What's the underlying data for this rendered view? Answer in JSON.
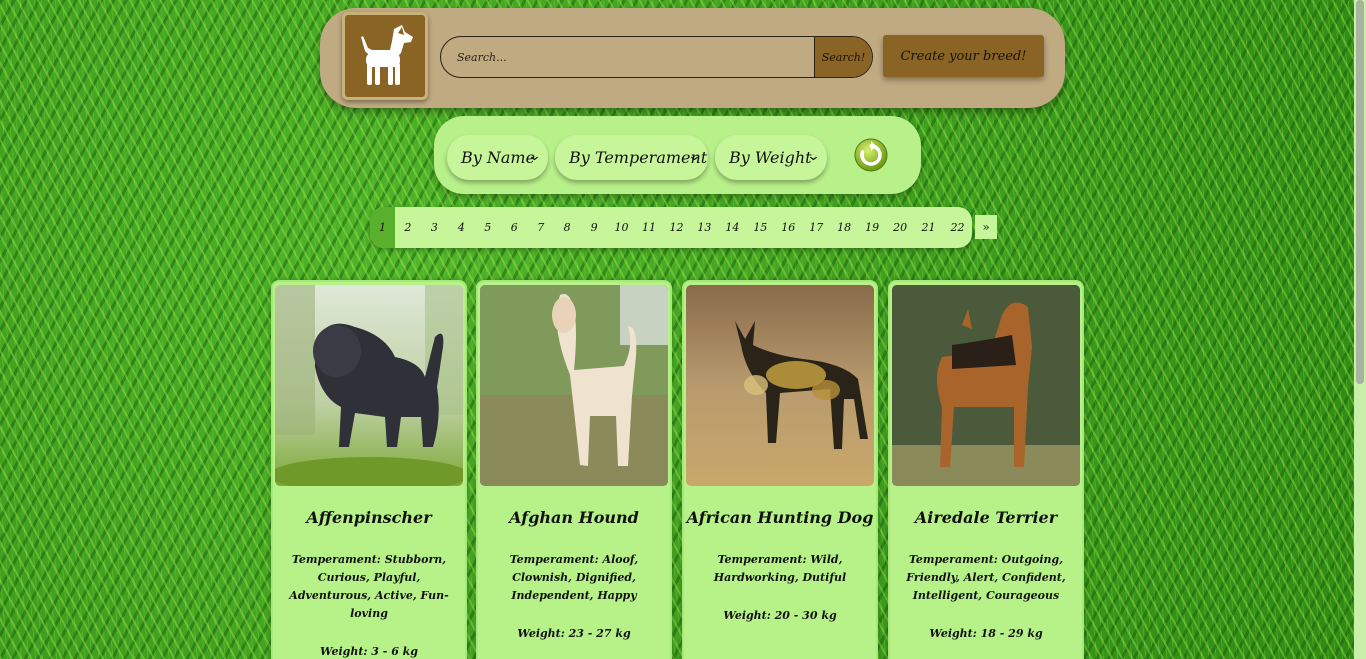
{
  "header": {
    "search_placeholder": "Search...",
    "search_button": "Search!",
    "create_button": "Create your breed!"
  },
  "filters": {
    "by_name": "By Name",
    "by_temperament": "By Temperament",
    "by_weight": "By Weight"
  },
  "pagination": {
    "pages": [
      "1",
      "2",
      "3",
      "4",
      "5",
      "6",
      "7",
      "8",
      "9",
      "10",
      "11",
      "12",
      "13",
      "14",
      "15",
      "16",
      "17",
      "18",
      "19",
      "20",
      "21",
      "22"
    ],
    "active": "1",
    "next": "»"
  },
  "cards": [
    {
      "name": "Affenpinscher",
      "temperament": "Temperament: Stubborn, Curious, Playful, Adventurous, Active, Fun-loving",
      "weight": "Weight: 3 - 6 kg"
    },
    {
      "name": "Afghan Hound",
      "temperament": "Temperament: Aloof, Clownish, Dignified, Independent, Happy",
      "weight": "Weight: 23 - 27 kg"
    },
    {
      "name": "African Hunting Dog",
      "temperament": "Temperament: Wild, Hardworking, Dutiful",
      "weight": "Weight: 20 - 30 kg"
    },
    {
      "name": "Airedale Terrier",
      "temperament": "Temperament: Outgoing, Friendly, Alert, Confident, Intelligent, Courageous",
      "weight": "Weight: 18 - 29 kg"
    }
  ],
  "colors": {
    "header_bg": "#c0aa82",
    "brown": "#8a6424",
    "panel_green": "#b8f08a",
    "active_page": "#58b02c"
  }
}
